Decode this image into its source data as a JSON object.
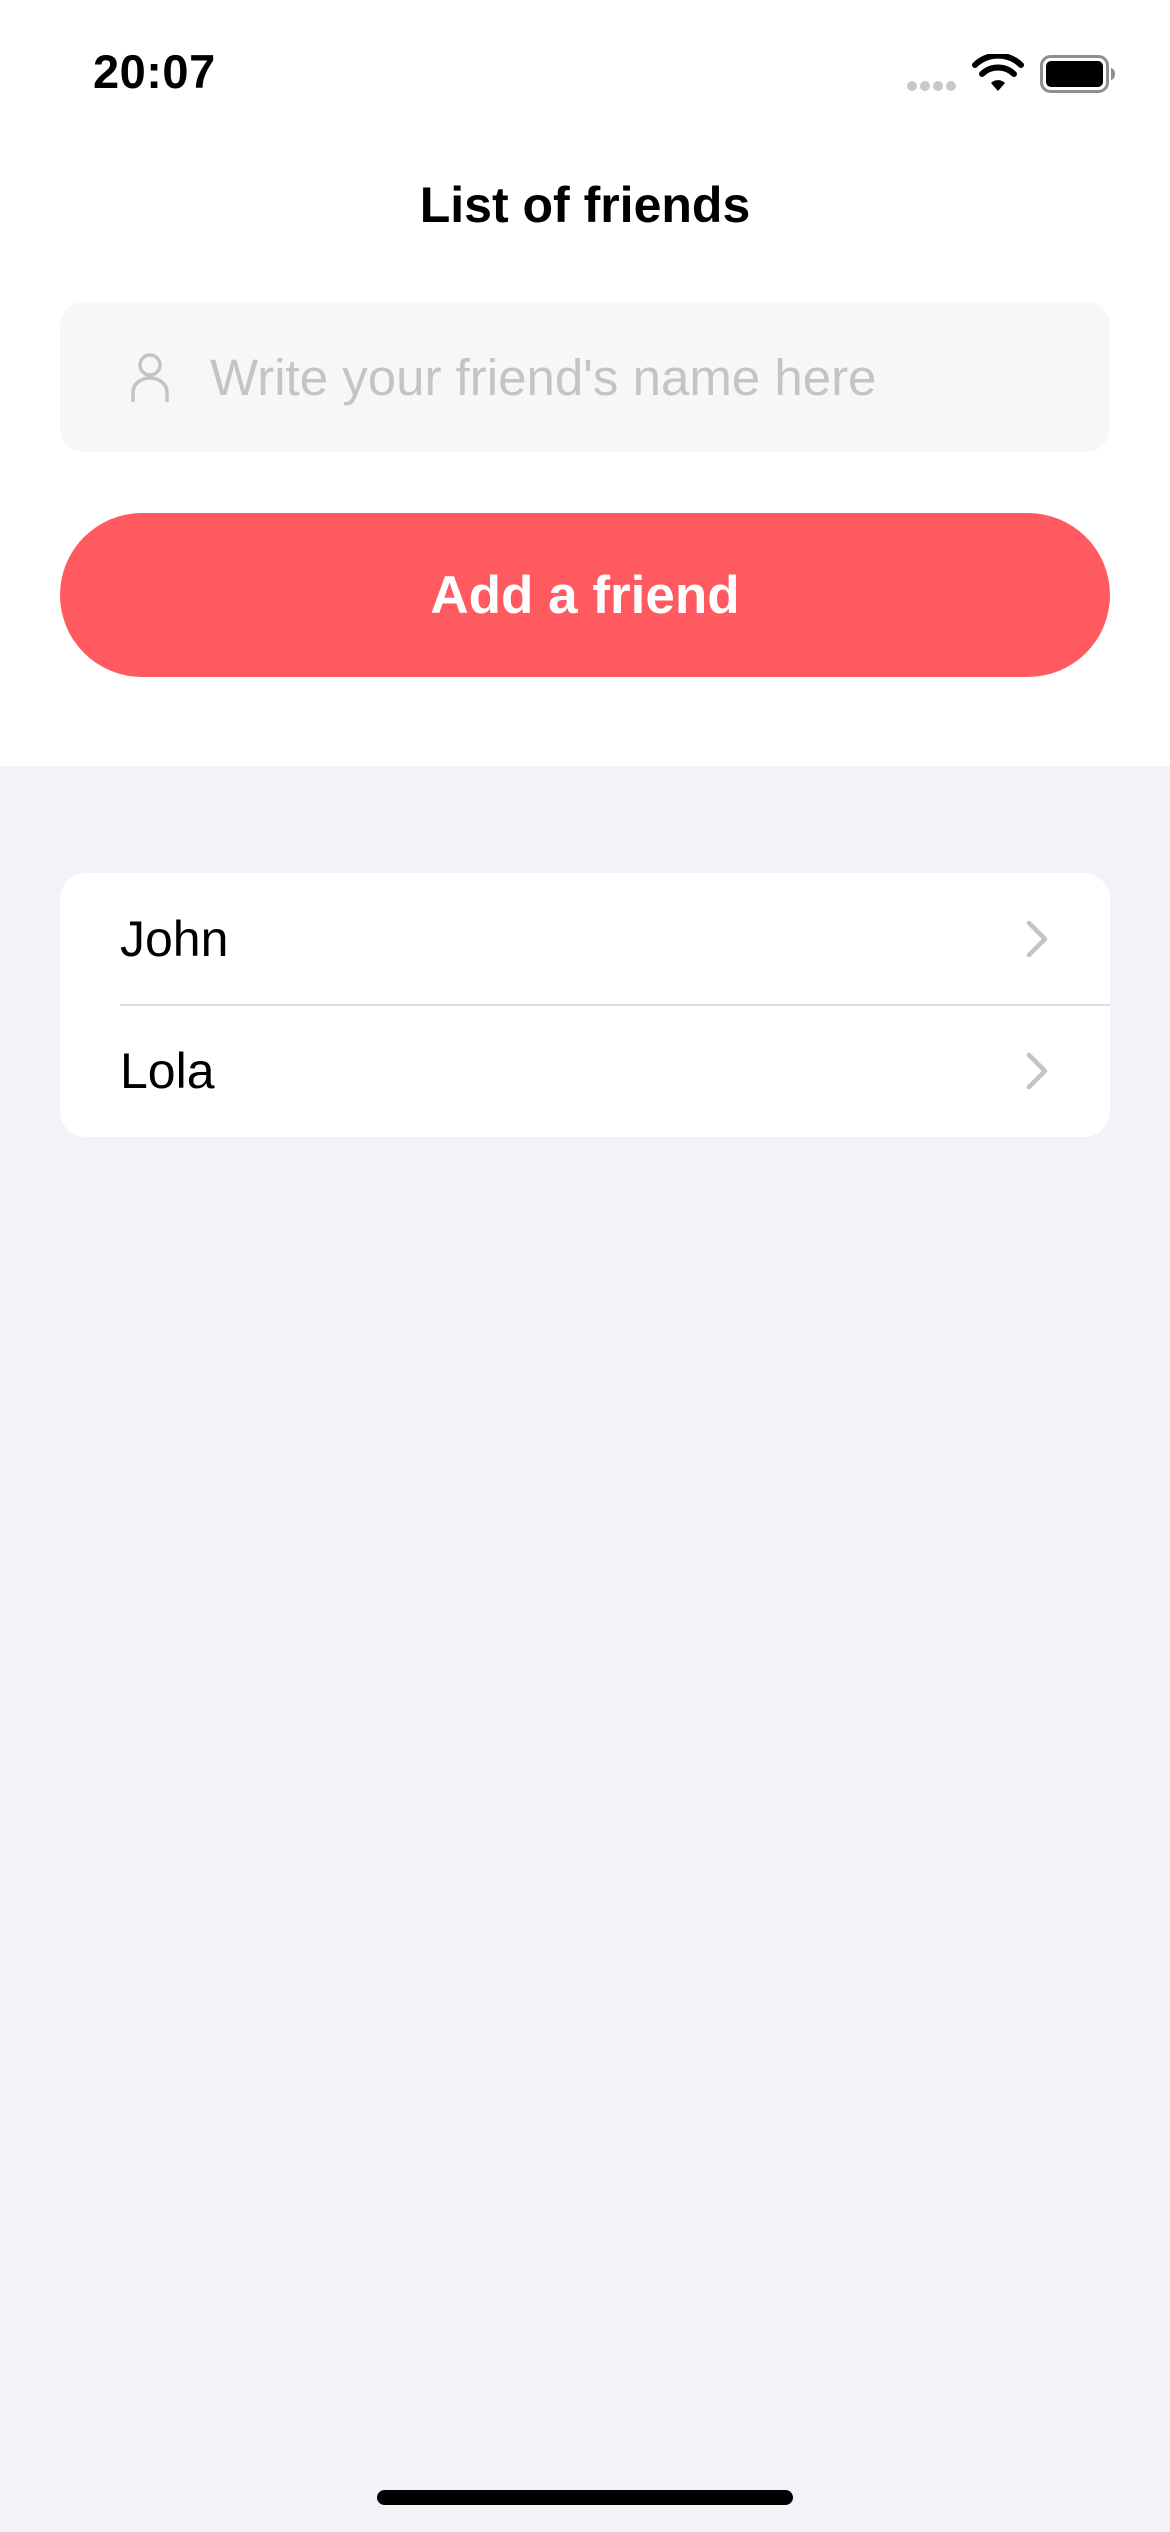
{
  "status_bar": {
    "time": "20:07",
    "icons": [
      "signal-icon",
      "wifi-icon",
      "battery-icon"
    ]
  },
  "header": {
    "title": "List of friends"
  },
  "form": {
    "input_icon": "person-icon",
    "input_placeholder": "Write your friend's name here",
    "input_value": "",
    "button_label": "Add a friend"
  },
  "friends": {
    "items": [
      {
        "label": "John",
        "icon": "chevron-right-icon"
      },
      {
        "label": "Lola",
        "icon": "chevron-right-icon"
      }
    ]
  },
  "colors": {
    "accent": "#fe5a5f",
    "page_background": "#f2f2f7",
    "input_background": "#f7f7f7",
    "placeholder": "#c4c4c6",
    "chevron": "#c4c4c6"
  }
}
